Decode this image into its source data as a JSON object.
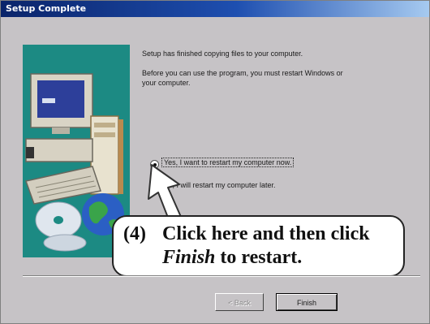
{
  "window": {
    "title": "Setup Complete"
  },
  "message": {
    "line1": "Setup has finished copying files to your computer.",
    "line2": "Before you can use the program, you must restart Windows or",
    "line3": "your computer."
  },
  "options": [
    {
      "label": "Yes, I want to restart my computer now.",
      "selected": true
    },
    {
      "label": "No, I will restart my computer later.",
      "selected": false
    }
  ],
  "buttons": {
    "back": "< Back",
    "finish": "Finish"
  },
  "callout": {
    "number": "(4)",
    "line1": "Click here and then click",
    "line2_emph": "Finish",
    "line2_rest": " to restart."
  },
  "colors": {
    "title_bar": "#0a246a",
    "art_background": "#1c8a83",
    "dialog": "#c6c3c6"
  },
  "icons": [
    "computer-illustration-icon",
    "cd-disc-icon",
    "globe-icon",
    "pointer-arrow-icon"
  ]
}
